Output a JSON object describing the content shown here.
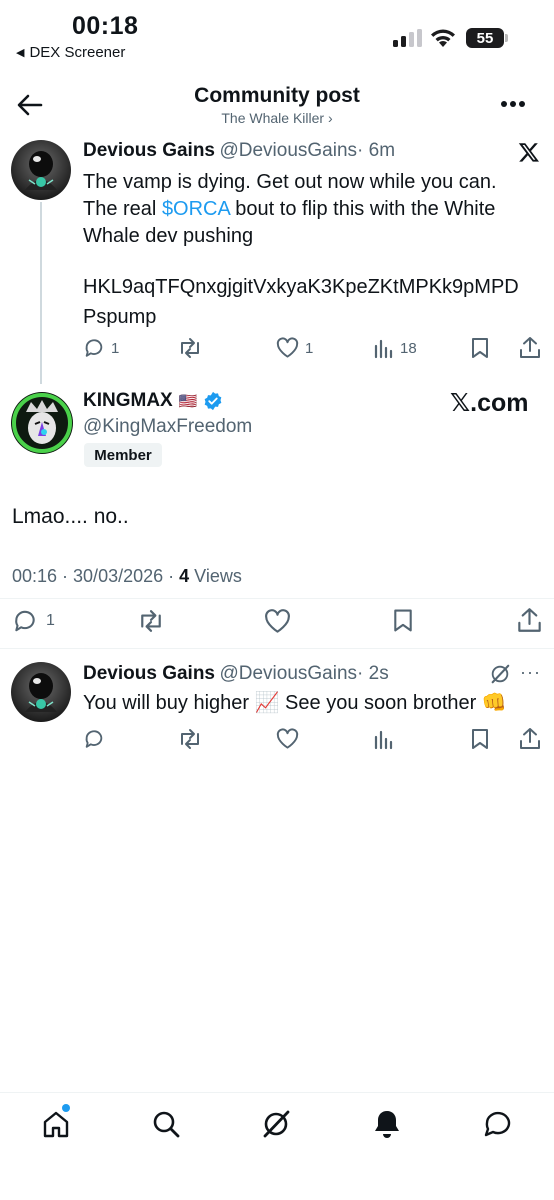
{
  "status_bar": {
    "time": "00:18",
    "back_app": "DEX Screener",
    "battery": "55"
  },
  "header": {
    "title": "Community post",
    "subtitle": "The Whale Killer ›"
  },
  "post1": {
    "name": "Devious Gains",
    "handle": "@DeviousGains",
    "time": "· 6m",
    "line1": "The vamp is dying. Get out now while you can.",
    "line2_prefix": "The real ",
    "ticker": "$ORCA",
    "line2_suffix": " bout to flip this with the White",
    "line3": "Whale dev pushing",
    "address_line1": "HKL9aqTFQnxgjgitVxkyaK3KpeZKtMPKk9pMPD",
    "address_line2": "Pspump",
    "replies": "1",
    "likes": "1",
    "views": "18",
    "source_icon": "x-logo-icon"
  },
  "post2": {
    "name": "KINGMAX",
    "flag": "🇺🇸",
    "handle": "@KingMaxFreedom",
    "badge": "Member",
    "watermark": "𝕏.com",
    "text": "Lmao.... no..",
    "timestamp": "00:16 · 30/03/2026 · ",
    "views_count": "4",
    "views_label": " Views",
    "replies": "1"
  },
  "reply": {
    "name": "Devious Gains",
    "handle": "@DeviousGains",
    "time": "· 2s",
    "text_prefix": "You will buy higher ",
    "emoji1": "📈",
    "text_middle": " See you soon brother ",
    "emoji2": "👊",
    "more": "···"
  },
  "tabbar": {
    "items": [
      "home-icon",
      "search-icon",
      "grok-icon",
      "notifications-icon",
      "messages-icon"
    ]
  },
  "colors": {
    "accent": "#1d9bf0",
    "verified": "#1d9bf0",
    "secondary_text": "#536471"
  }
}
